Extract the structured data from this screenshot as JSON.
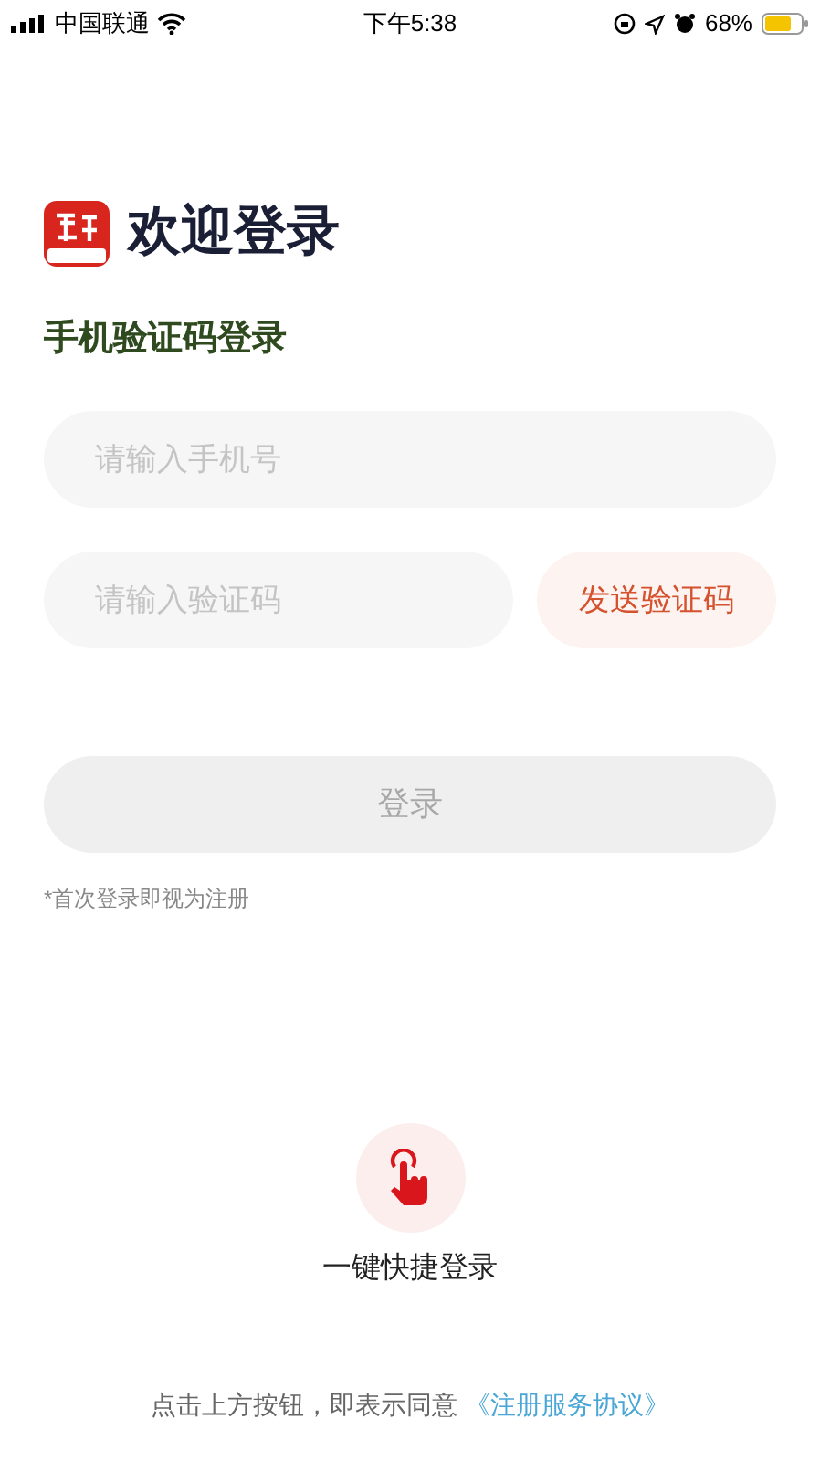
{
  "status_bar": {
    "carrier": "中国联通",
    "time": "下午5:38",
    "battery": "68%"
  },
  "header": {
    "title": "欢迎登录"
  },
  "subtitle": "手机验证码登录",
  "phone_field": {
    "placeholder": "请输入手机号"
  },
  "code_field": {
    "placeholder": "请输入验证码"
  },
  "send_code_button": "发送验证码",
  "login_button": {
    "label": "登录",
    "disabled": true
  },
  "note": "*首次登录即视为注册",
  "quick_login": {
    "label": "一键快捷登录"
  },
  "agreement": {
    "text": "点击上方按钮，即表示同意",
    "link": "《注册服务协议》"
  }
}
